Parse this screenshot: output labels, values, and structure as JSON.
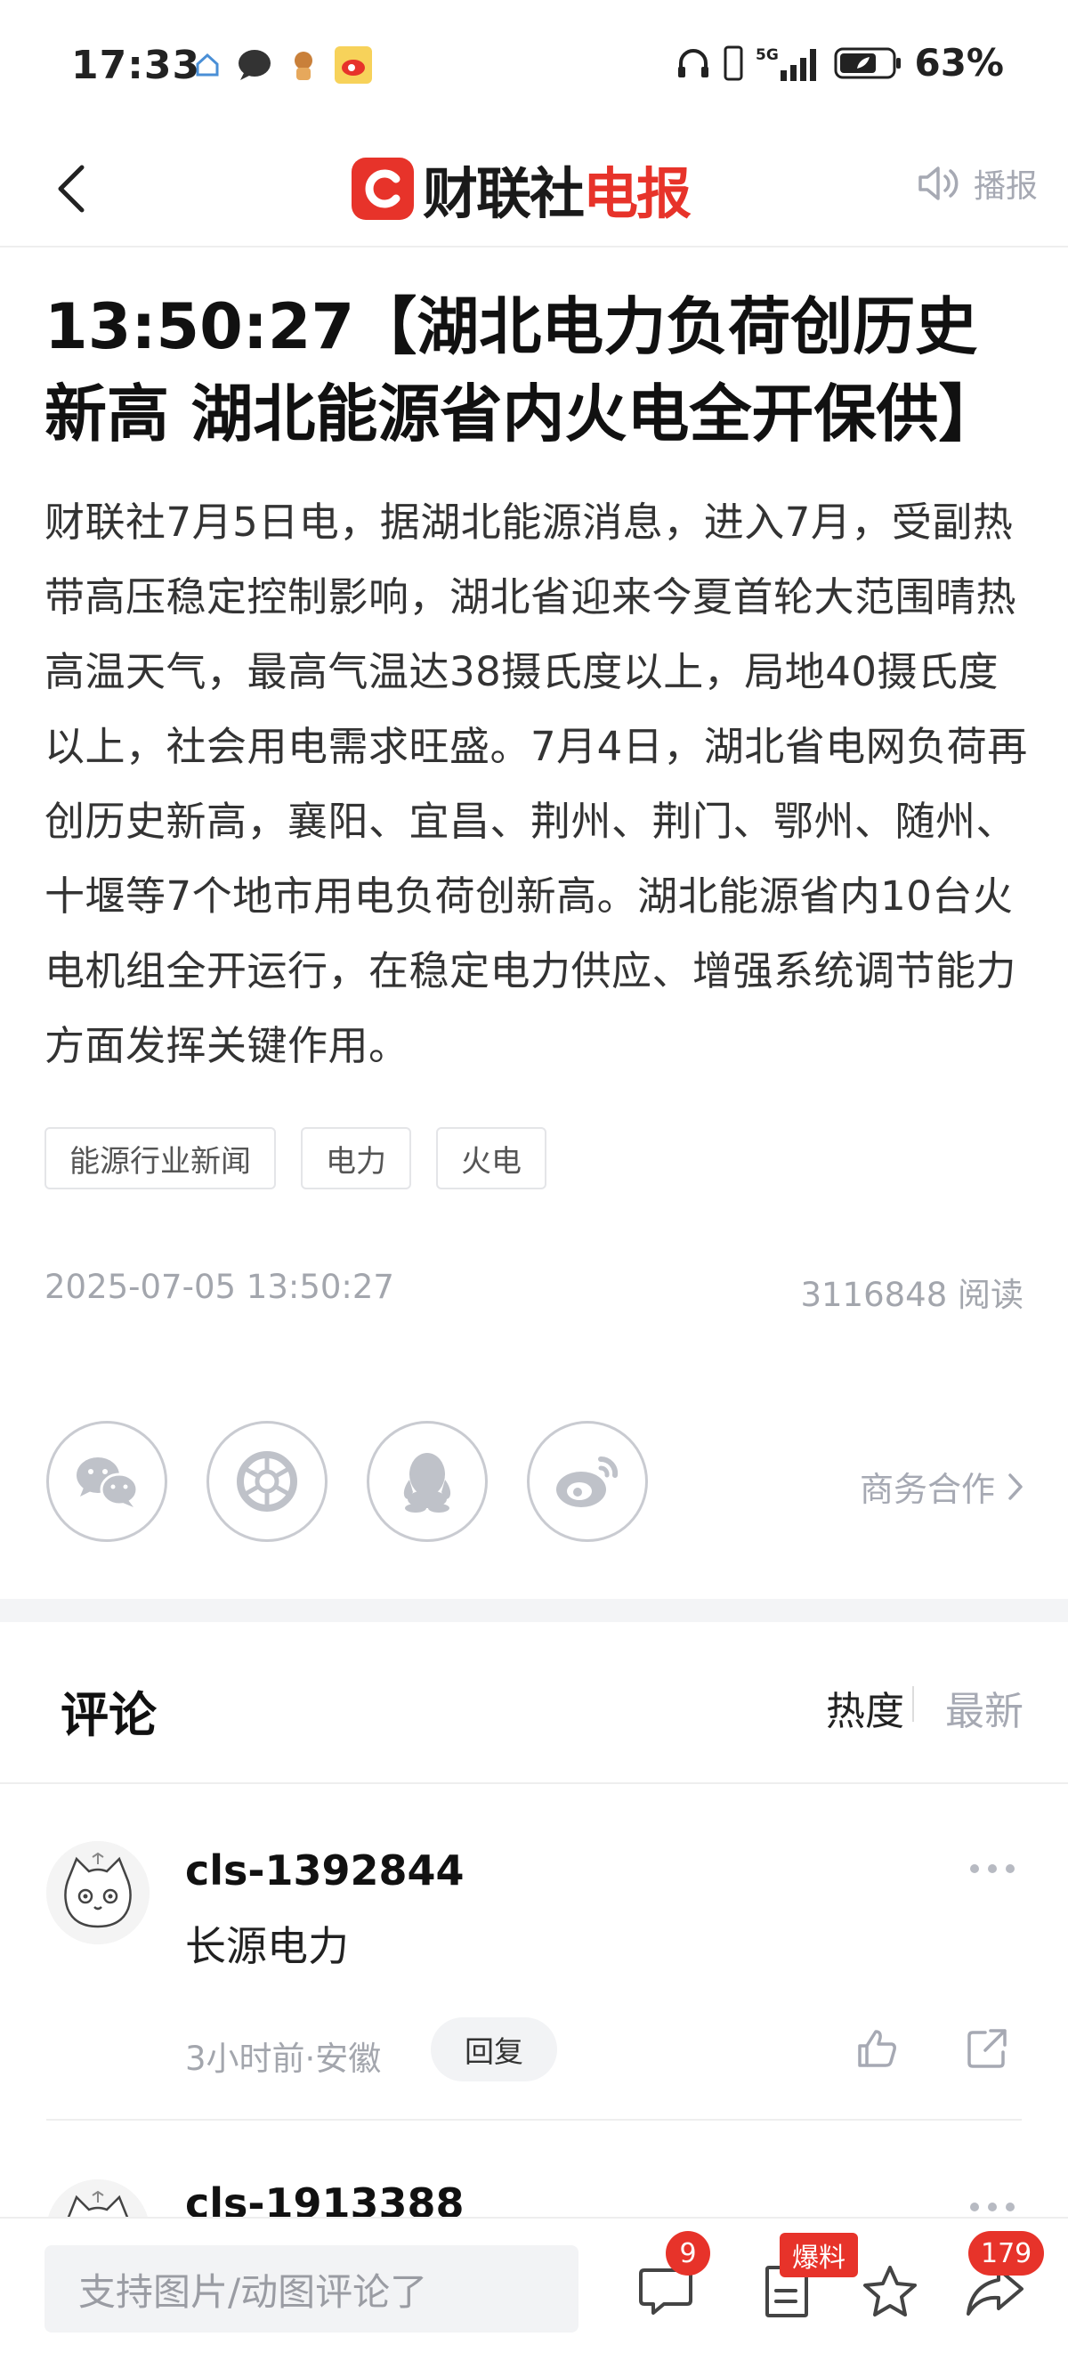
{
  "status_bar": {
    "time": "17:33",
    "network": "5G",
    "battery": "63%"
  },
  "nav": {
    "logo_prefix": "财联社",
    "logo_suffix": "电报",
    "broadcast_label": "播报"
  },
  "article": {
    "title": "13:50:27【湖北电力负荷创历史新高 湖北能源省内火电全开保供】",
    "body": "财联社7月5日电，据湖北能源消息，进入7月，受副热带高压稳定控制影响，湖北省迎来今夏首轮大范围晴热高温天气，最高气温达38摄氏度以上，局地40摄氏度以上，社会用电需求旺盛。7月4日，湖北省电网负荷再创历史新高，襄阳、宜昌、荆州、荆门、鄂州、随州、十堰等7个地市用电负荷创新高。湖北能源省内10台火电机组全开运行，在稳定电力供应、增强系统调节能力方面发挥关键作用。",
    "tags": [
      "能源行业新闻",
      "电力",
      "火电"
    ],
    "time": "2025-07-05 13:50:27",
    "reads": "3116848 阅读"
  },
  "share": {
    "business_link": "商务合作"
  },
  "comments": {
    "title": "评论",
    "sort_hot": "热度",
    "sort_new": "最新",
    "items": [
      {
        "user": "cls-1392844",
        "text": "长源电力",
        "meta": "3小时前·安徽",
        "reply": "回复"
      },
      {
        "user": "cls-1913388"
      }
    ]
  },
  "bottom_bar": {
    "input_placeholder": "支持图片/动图评论了",
    "comment_count": "9",
    "report_label": "爆料",
    "share_count": "179"
  },
  "colors": {
    "brand_red": "#e7332a",
    "muted_text": "#a3a6ad",
    "divider": "#eeeeee"
  },
  "icons": [
    "back-arrow-icon",
    "speaker-icon",
    "wechat-icon",
    "moments-icon",
    "qq-icon",
    "weibo-icon",
    "chevron-right-icon",
    "more-dots-icon",
    "thumbs-up-icon",
    "share-icon",
    "comment-icon",
    "report-icon",
    "star-icon",
    "forward-icon"
  ]
}
